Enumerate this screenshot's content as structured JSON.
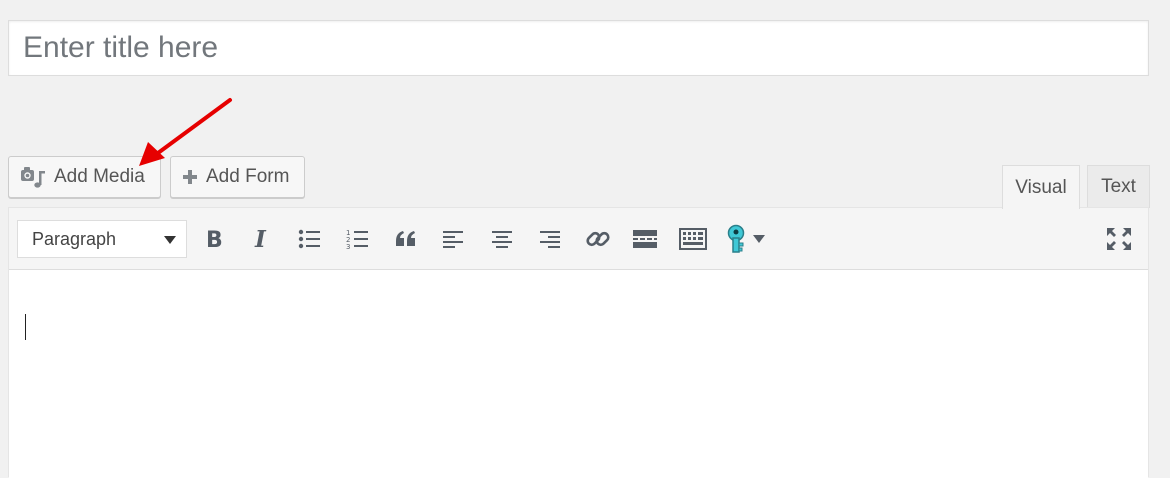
{
  "title_field": {
    "placeholder": "Enter title here"
  },
  "buttons": {
    "add_media": "Add Media",
    "add_form": "Add Form"
  },
  "tabs": {
    "visual": "Visual",
    "text": "Text"
  },
  "toolbar": {
    "format_select": "Paragraph"
  },
  "colors": {
    "annotation_arrow": "#e60000",
    "toolbar_bg": "#f5f5f5",
    "icon": "#555d66",
    "key_icon": "#3fc8d6"
  },
  "icons": [
    "add-media-icon",
    "plus-icon",
    "bold-icon",
    "italic-icon",
    "bullet-list-icon",
    "numbered-list-icon",
    "blockquote-icon",
    "align-left-icon",
    "align-center-icon",
    "align-right-icon",
    "link-icon",
    "read-more-icon",
    "toolbar-toggle-icon",
    "key-icon",
    "dropdown-arrow-icon",
    "fullscreen-icon"
  ]
}
